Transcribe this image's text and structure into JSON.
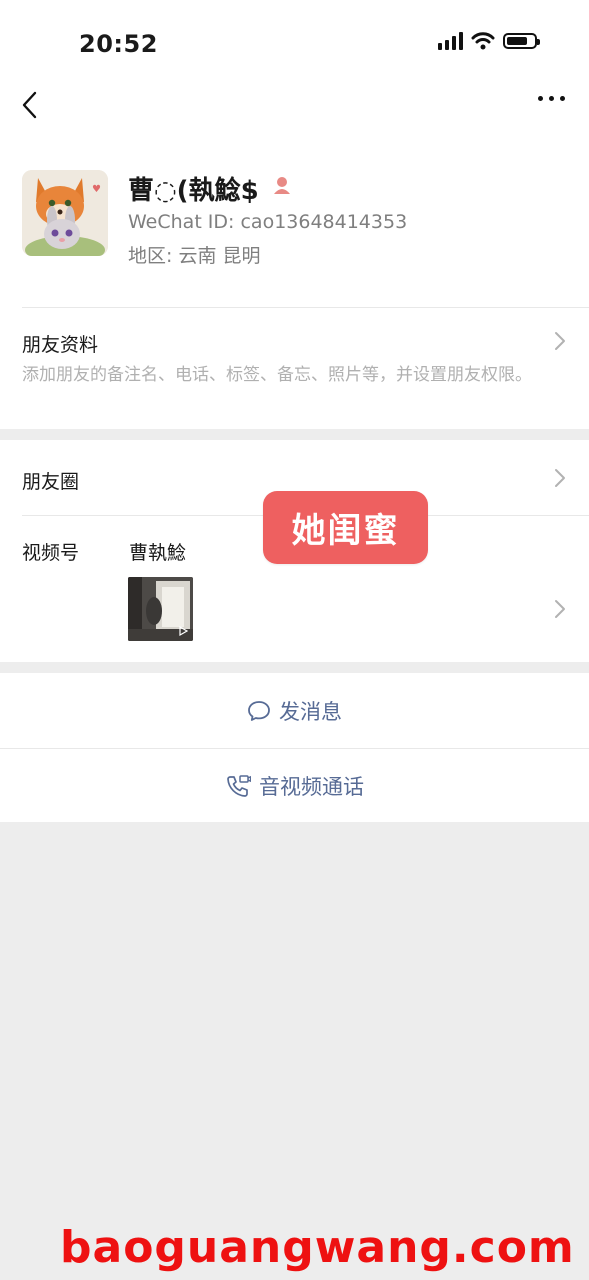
{
  "status_bar": {
    "time": "20:52"
  },
  "profile": {
    "name": "曹◌(𦖋$",
    "name_display": "曹◌(執鯰$",
    "wechat_id": "WeChat ID: cao13648414353",
    "region": "地区: 云南 昆明"
  },
  "friend_info": {
    "title": "朋友资料",
    "description": "添加朋友的备注名、电话、标签、备忘、照片等，并设置朋友权限。"
  },
  "moments": {
    "title": "朋友圈"
  },
  "channels": {
    "title": "视频号",
    "channel_name": "曹執鯰"
  },
  "actions": {
    "message": "发消息",
    "call": "音视频通话"
  },
  "sticker_text": "她闺蜜",
  "watermark": "baoguangwang.com",
  "icons": [
    "back-icon",
    "more-icon",
    "gender-icon",
    "chevron-right-icon",
    "message-icon",
    "phone-icon",
    "play-icon"
  ],
  "colors": {
    "link_blue": "#576b95",
    "sticker_red": "#ee6060",
    "watermark_red": "#ee1111",
    "secondary_text": "#7f7f7f"
  }
}
